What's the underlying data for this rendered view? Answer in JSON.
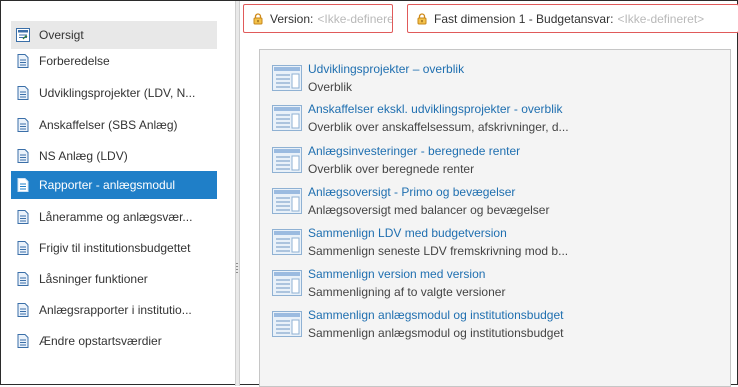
{
  "sidebar": {
    "items": [
      {
        "label": "Oversigt",
        "icon": "overview-icon"
      },
      {
        "label": "Forberedelse",
        "icon": "document-icon"
      },
      {
        "label": "Udviklingsprojekter (LDV, N...",
        "icon": "document-icon"
      },
      {
        "label": "Anskaffelser (SBS Anlæg)",
        "icon": "document-icon"
      },
      {
        "label": "NS Anlæg (LDV)",
        "icon": "document-icon"
      },
      {
        "label": "Rapporter - anlægsmodul",
        "icon": "document-icon",
        "active": true
      },
      {
        "label": "Låneramme og anlægsvær...",
        "icon": "document-icon"
      },
      {
        "label": "Frigiv til institutionsbudgettet",
        "icon": "document-icon"
      },
      {
        "label": "Låsninger funktioner",
        "icon": "document-icon"
      },
      {
        "label": "Anlægsrapporter i institutio...",
        "icon": "document-icon"
      },
      {
        "label": "Ændre opstartsværdier",
        "icon": "document-icon"
      }
    ]
  },
  "filters": [
    {
      "label": "Version:",
      "value": "<Ikke-defineret>",
      "icon": "lock-icon"
    },
    {
      "label": "Fast dimension 1 - Budgetansvar:",
      "value": "<Ikke-defineret>",
      "icon": "lock-icon"
    }
  ],
  "reports": [
    {
      "title": "Udviklingsprojekter – overblik",
      "description": "Overblik"
    },
    {
      "title": "Anskaffelser ekskl. udviklingsprojekter - overblik",
      "description": "Overblik over anskaffelsessum, afskrivninger, d..."
    },
    {
      "title": "Anlægsinvesteringer - beregnede renter",
      "description": "Overblik over beregnede renter"
    },
    {
      "title": "Anlægsoversigt - Primo og bevægelser",
      "description": "Anlægsoversigt med balancer og bevægelser"
    },
    {
      "title": "Sammenlign LDV med budgetversion",
      "description": "Sammenlign seneste LDV fremskrivning mod b..."
    },
    {
      "title": "Sammenlign version med version",
      "description": "Sammenligning af to valgte versioner"
    },
    {
      "title": "Sammenlign anlægsmodul og institutionsbudget",
      "description": "Sammenlign anlægsmodul og institutionsbudget"
    }
  ],
  "colors": {
    "accent": "#1f7fc8",
    "link": "#1f6fb0",
    "filter_border": "#e05a5a"
  }
}
